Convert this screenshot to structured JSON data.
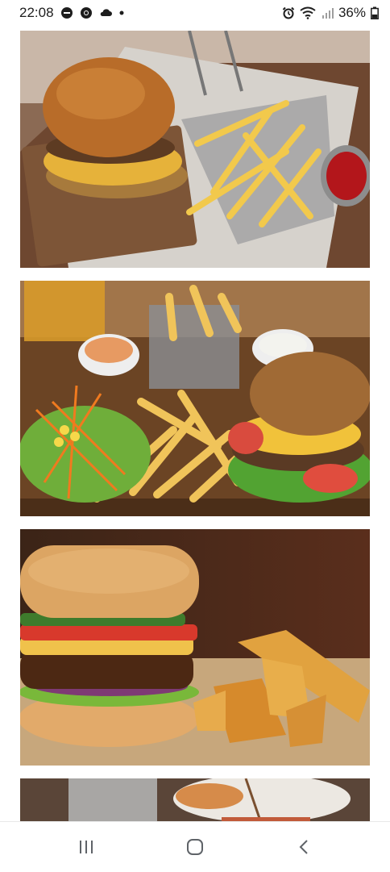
{
  "status": {
    "time": "22:08",
    "battery": "36%",
    "icons_left": [
      "dnd-icon",
      "chrome-icon",
      "cloud-icon",
      "dot-icon"
    ],
    "icons_right": [
      "alarm-icon",
      "wifi-icon",
      "signal-icon",
      "battery-icon"
    ]
  },
  "feed": {
    "images": [
      {
        "name": "burger-with-fries-basket-photo"
      },
      {
        "name": "burger-salad-fries-board-photo"
      },
      {
        "name": "burger-with-potato-wedges-photo"
      },
      {
        "name": "partial-food-photo"
      }
    ]
  },
  "nav": {
    "icons": [
      "recent-apps-icon",
      "home-icon",
      "back-icon"
    ]
  },
  "colors": {
    "background": "#ffffff",
    "nav_icon": "#5f6368"
  }
}
